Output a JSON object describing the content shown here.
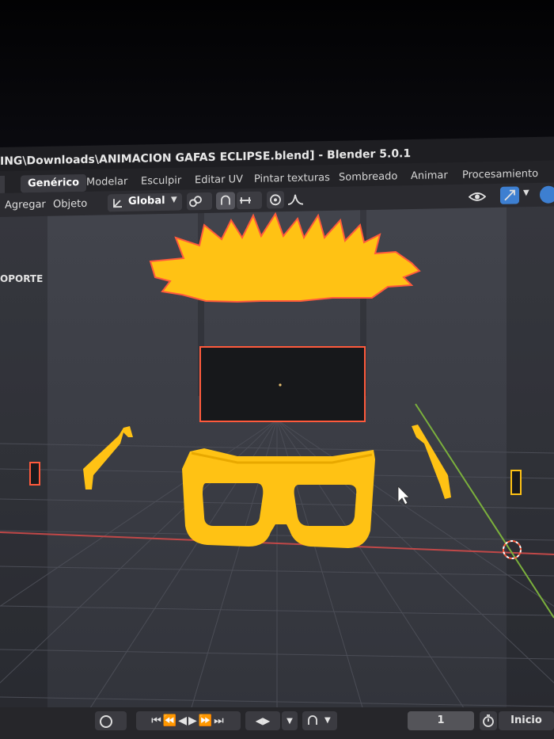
{
  "window": {
    "title": "ING\\Downloads\\ANIMACION GAFAS ECLIPSE.blend] - Blender 5.0.1"
  },
  "workspaces": {
    "tabs": [
      {
        "label": "Genérico",
        "active": true
      },
      {
        "label": "Modelar"
      },
      {
        "label": "Esculpir"
      },
      {
        "label": "Editar UV"
      },
      {
        "label": "Pintar texturas"
      },
      {
        "label": "Sombreado"
      },
      {
        "label": "Animar"
      },
      {
        "label": "Procesamiento"
      }
    ]
  },
  "viewport_header": {
    "menu_add": "Agregar",
    "menu_object": "Objeto",
    "transform_orientation": "Global"
  },
  "viewport": {
    "overlay_text": "OPORTE",
    "accent_colors": {
      "object_fill": "#FFC214",
      "selection_outline": "#FF5A3C",
      "background": "#3E4048",
      "x_axis": "#C04848",
      "y_axis": "#7BB03C"
    }
  },
  "timeline": {
    "current_frame": "1",
    "start_label": "Inicio"
  }
}
